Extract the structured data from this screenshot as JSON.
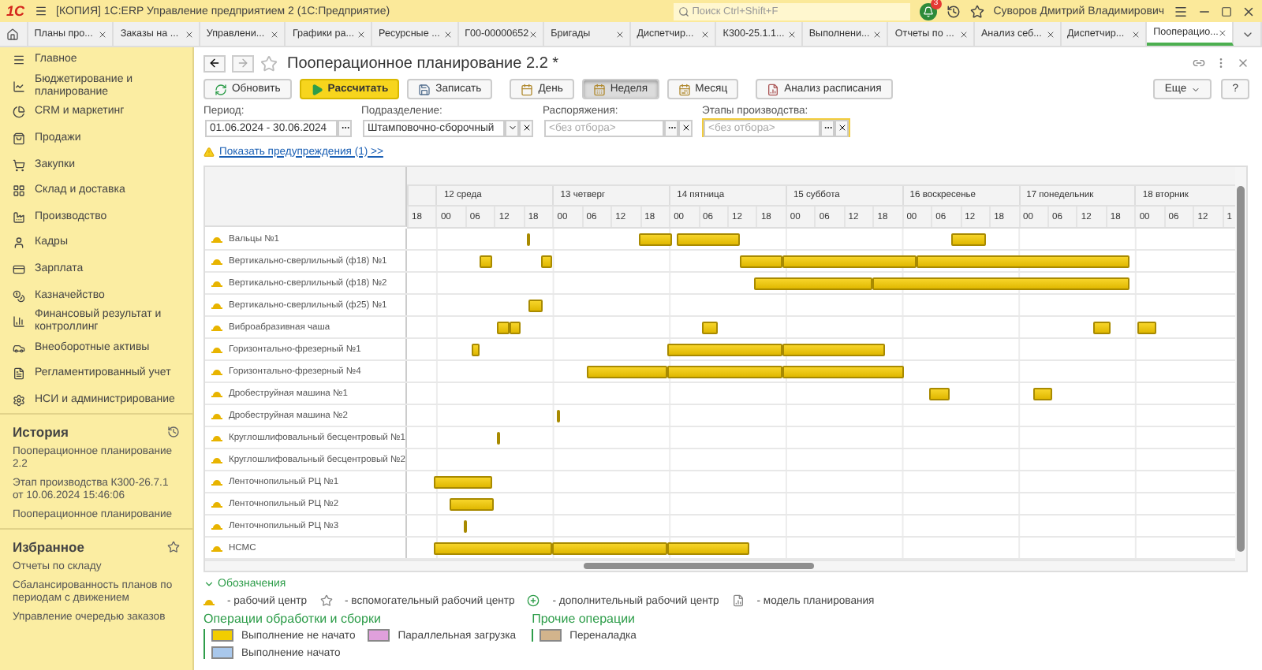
{
  "window": {
    "logo": "1С",
    "title": "[КОПИЯ] 1С:ERP Управление предприятием 2  (1С:Предприятие)",
    "search": {
      "placeholder": "Поиск Ctrl+Shift+F"
    },
    "notifications": "3",
    "user": "Суворов Дмитрий Владимирович"
  },
  "tabs": [
    {
      "label": "Планы про...",
      "selected": false
    },
    {
      "label": "Заказы на ...",
      "selected": false
    },
    {
      "label": "Управлени...",
      "selected": false
    },
    {
      "label": "Графики ра...",
      "selected": false
    },
    {
      "label": "Ресурсные ...",
      "selected": false
    },
    {
      "label": "Г00-00000652",
      "selected": false
    },
    {
      "label": "Бригады",
      "selected": false
    },
    {
      "label": "Диспетчир...",
      "selected": false
    },
    {
      "label": "К300-25.1.1...",
      "selected": false
    },
    {
      "label": "Выполнени...",
      "selected": false
    },
    {
      "label": "Отчеты по ...",
      "selected": false
    },
    {
      "label": "Анализ себ...",
      "selected": false
    },
    {
      "label": "Диспетчир...",
      "selected": false
    },
    {
      "label": "Пооперацио...",
      "selected": true
    }
  ],
  "sidebar": {
    "items": [
      {
        "label": "Главное"
      },
      {
        "label": "Бюджетирование и планирование"
      },
      {
        "label": "CRM и маркетинг"
      },
      {
        "label": "Продажи"
      },
      {
        "label": "Закупки"
      },
      {
        "label": "Склад и доставка"
      },
      {
        "label": "Производство"
      },
      {
        "label": "Кадры"
      },
      {
        "label": "Зарплата"
      },
      {
        "label": "Казначейство"
      },
      {
        "label": "Финансовый результат и контроллинг"
      },
      {
        "label": "Внеоборотные активы"
      },
      {
        "label": "Регламентированный учет"
      },
      {
        "label": "НСИ и администрирование"
      }
    ],
    "history": {
      "title": "История",
      "items": [
        "Пооперационное планирование 2.2",
        "Этап производства К300-26.7.1 от 10.06.2024 15:46:06",
        "Пооперационное планирование"
      ]
    },
    "favorites": {
      "title": "Избранное",
      "items": [
        "Отчеты по складу",
        "Сбалансированность планов по периодам с движением",
        "Управление очередью заказов"
      ]
    }
  },
  "form": {
    "title": "Пооперационное планирование 2.2 *",
    "actions": [
      {
        "kind": "refresh",
        "label": "Обновить"
      },
      {
        "kind": "calculate",
        "label": "Рассчитать"
      },
      {
        "kind": "save",
        "label": "Записать"
      }
    ],
    "scale": [
      {
        "kind": "day",
        "label": "День",
        "selected": false
      },
      {
        "kind": "week",
        "label": "Неделя",
        "selected": true
      },
      {
        "kind": "month",
        "label": "Месяц",
        "selected": false
      }
    ],
    "analysis": "Анализ расписания",
    "more": "Еще",
    "help": "?",
    "filters": [
      {
        "kind": "choice",
        "label": "Период:",
        "value": "01.06.2024 - 30.06.2024",
        "clearable": false,
        "focused": false
      },
      {
        "kind": "dropdown",
        "label": "Подразделение:",
        "value": "Штамповочно-сборочный",
        "clearable": true,
        "focused": false
      },
      {
        "kind": "choice",
        "label": "Распоряжения:",
        "placeholder": "<без отбора>",
        "clearable": true,
        "focused": false
      },
      {
        "kind": "choice",
        "label": "Этапы производства:",
        "placeholder": "<без отбора>",
        "clearable": true,
        "focused": true
      }
    ],
    "warning": "Показать предупреждения (1) >>"
  },
  "gantt": {
    "days": [
      "12 среда",
      "13 четверг",
      "14 пятница",
      "15 суббота",
      "16 воскресенье",
      "17 понедельник",
      "18 вторник"
    ],
    "hours": [
      "18",
      "00",
      "06",
      "12",
      "18",
      "00",
      "06",
      "12",
      "18",
      "00",
      "06",
      "12",
      "18",
      "00",
      "06",
      "12",
      "18",
      "00",
      "06",
      "12",
      "18",
      "00",
      "06",
      "12",
      "18",
      "00",
      "06",
      "12",
      "1"
    ],
    "rows": [
      {
        "name": "Вальцы №1"
      },
      {
        "name": "Вертикально-сверлильный (ф18) №1"
      },
      {
        "name": "Вертикально-сверлильный (ф18) №2"
      },
      {
        "name": "Вертикально-сверлильный (ф25) №1"
      },
      {
        "name": "Виброабразивная чаша"
      },
      {
        "name": "Горизонтально-фрезерный №1"
      },
      {
        "name": "Горизонтально-фрезерный №4"
      },
      {
        "name": "Дробеструйная машина №1"
      },
      {
        "name": "Дробеструйная машина №2"
      },
      {
        "name": "Круглошлифовальный бесцентровый №1"
      },
      {
        "name": "Круглошлифовальный бесцентровый №2"
      },
      {
        "name": "Ленточнопильный РЦ №1"
      },
      {
        "name": "Ленточнопильный РЦ №2"
      },
      {
        "name": "Ленточнопильный РЦ №3"
      },
      {
        "name": "НСМС"
      }
    ]
  },
  "legend": {
    "title": "Обозначения",
    "expanded": true,
    "symbols": [
      {
        "kind": "work-center",
        "label": "- рабочий центр"
      },
      {
        "kind": "auxiliary",
        "label": "- вспомогательный рабочий центр"
      },
      {
        "kind": "additional",
        "label": "- дополнительный рабочий центр"
      },
      {
        "kind": "model",
        "label": "- модель планирования"
      }
    ],
    "groups": [
      {
        "title": "Операции обработки и сборки",
        "items": [
          {
            "label": "Выполнение не начато",
            "color": "#f2cd00"
          },
          {
            "label": "Параллельная загрузка",
            "color": "#e0a0dc"
          },
          {
            "label": "Выполнение начато",
            "color": "#a9c8ec"
          }
        ]
      },
      {
        "title": "Прочие операции",
        "items": [
          {
            "label": "Переналадка",
            "color": "#d2b48c"
          }
        ]
      }
    ]
  }
}
